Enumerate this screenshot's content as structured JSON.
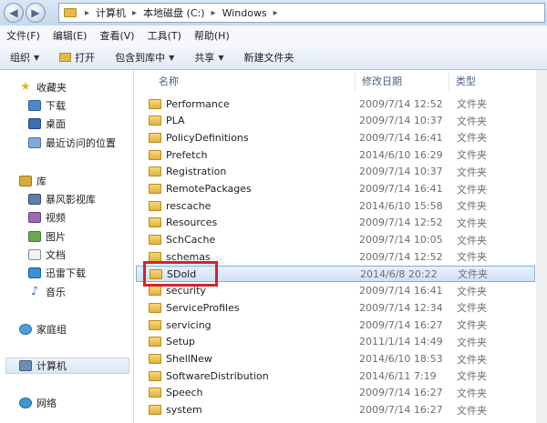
{
  "address": {
    "crumbs": [
      "计算机",
      "本地磁盘 (C:)",
      "Windows"
    ]
  },
  "menubar": [
    "文件(F)",
    "编辑(E)",
    "查看(V)",
    "工具(T)",
    "帮助(H)"
  ],
  "toolbar": {
    "organize": "组织",
    "open": "打开",
    "include": "包含到库中",
    "share": "共享",
    "new_folder": "新建文件夹"
  },
  "sidebar": {
    "favorites": {
      "title": "收藏夹",
      "items": [
        "下载",
        "桌面",
        "最近访问的位置"
      ]
    },
    "libraries": {
      "title": "库",
      "items": [
        "暴风影视库",
        "视频",
        "图片",
        "文档",
        "迅雷下载",
        "音乐"
      ]
    },
    "homegroup": "家庭组",
    "computer": "计算机",
    "network": "网络"
  },
  "columns": {
    "name": "名称",
    "date": "修改日期",
    "type": "类型"
  },
  "files": [
    {
      "name": "Performance",
      "date": "2009/7/14 12:52",
      "type": "文件夹"
    },
    {
      "name": "PLA",
      "date": "2009/7/14 10:37",
      "type": "文件夹"
    },
    {
      "name": "PolicyDefinitions",
      "date": "2009/7/14 16:41",
      "type": "文件夹"
    },
    {
      "name": "Prefetch",
      "date": "2014/6/10 16:29",
      "type": "文件夹"
    },
    {
      "name": "Registration",
      "date": "2009/7/14 10:37",
      "type": "文件夹"
    },
    {
      "name": "RemotePackages",
      "date": "2009/7/14 16:41",
      "type": "文件夹"
    },
    {
      "name": "rescache",
      "date": "2014/6/10 15:58",
      "type": "文件夹"
    },
    {
      "name": "Resources",
      "date": "2009/7/14 12:52",
      "type": "文件夹"
    },
    {
      "name": "SchCache",
      "date": "2009/7/14 10:05",
      "type": "文件夹"
    },
    {
      "name": "schemas",
      "date": "2009/7/14 12:52",
      "type": "文件夹"
    },
    {
      "name": "SDold",
      "date": "2014/6/8 20:22",
      "type": "文件夹"
    },
    {
      "name": "security",
      "date": "2009/7/14 16:41",
      "type": "文件夹"
    },
    {
      "name": "ServiceProfiles",
      "date": "2009/7/14 12:34",
      "type": "文件夹"
    },
    {
      "name": "servicing",
      "date": "2009/7/14 16:27",
      "type": "文件夹"
    },
    {
      "name": "Setup",
      "date": "2011/1/14 14:49",
      "type": "文件夹"
    },
    {
      "name": "ShellNew",
      "date": "2014/6/10 18:53",
      "type": "文件夹"
    },
    {
      "name": "SoftwareDistribution",
      "date": "2014/6/11 7:19",
      "type": "文件夹"
    },
    {
      "name": "Speech",
      "date": "2009/7/14 16:27",
      "type": "文件夹"
    },
    {
      "name": "system",
      "date": "2009/7/14 16:27",
      "type": "文件夹"
    }
  ]
}
